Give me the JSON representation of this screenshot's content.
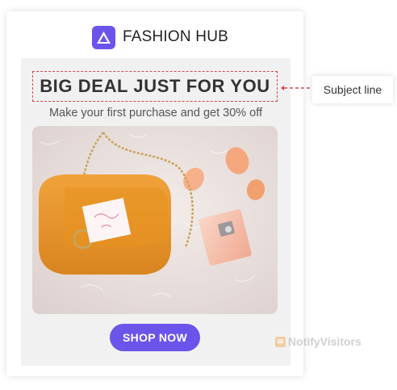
{
  "brand": {
    "name": "FASHION HUB",
    "logo_icon": "triangle-logo-icon",
    "accent": "#6b54ea"
  },
  "email": {
    "subject": "BIG DEAL JUST FOR YOU",
    "subtitle": "Make your first purchase and get 30% off",
    "hero_image": "orange-handbag-perfume-photo",
    "cta_label": "SHOP NOW"
  },
  "annotation": {
    "label": "Subject line",
    "highlight_color": "#d24a4a"
  },
  "watermark": {
    "text": "NotifyVisitors",
    "icon": "notifyvisitors-logo-icon"
  }
}
